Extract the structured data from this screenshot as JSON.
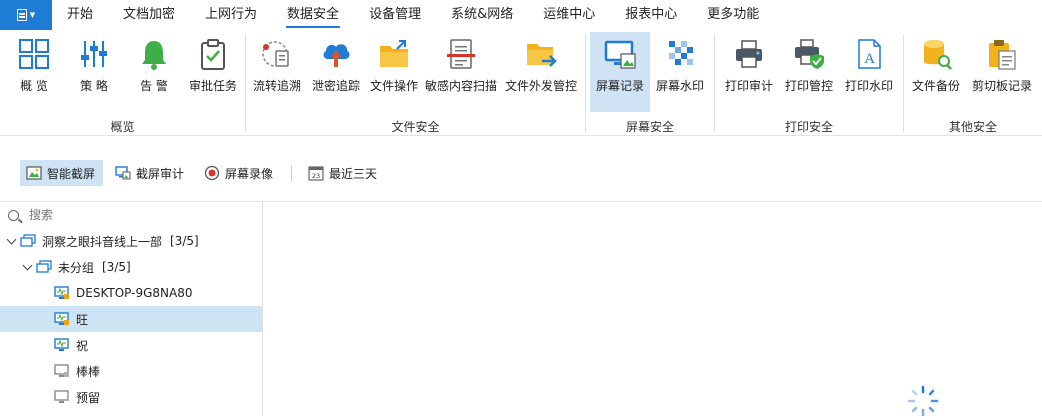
{
  "menu": {
    "items": [
      "开始",
      "文档加密",
      "上网行为",
      "数据安全",
      "设备管理",
      "系统&网络",
      "运维中心",
      "报表中心",
      "更多功能"
    ],
    "active": "数据安全"
  },
  "ribbon": {
    "buttons": {
      "overview": "概  览",
      "policy": "策  略",
      "alert": "告  警",
      "approval": "审批任务",
      "flow_trace": "流转追溯",
      "leak_trace": "泄密追踪",
      "file_ops": "文件操作",
      "sensitive_scan": "敏感内容扫描",
      "file_out": "文件外发管控",
      "screen_record": "屏幕记录",
      "screen_watermark": "屏幕水印",
      "print_audit": "打印审计",
      "print_control": "打印管控",
      "print_watermark": "打印水印",
      "file_backup": "文件备份",
      "clipboard": "剪切板记录"
    },
    "groups": {
      "overview": "概览",
      "file_security": "文件安全",
      "screen_security": "屏幕安全",
      "print_security": "打印安全",
      "other_security": "其他安全"
    }
  },
  "toolbar": {
    "smart_capture": "智能截屏",
    "capture_audit": "截屏审计",
    "screen_video": "屏幕录像",
    "recent_range": "最近三天",
    "calendar_day": "23"
  },
  "tree": {
    "search_placeholder": "搜索",
    "root": {
      "label": "洞察之眼抖音线上一部",
      "count": "[3/5]"
    },
    "group": {
      "label": "未分组",
      "count": "[3/5]"
    },
    "devices": [
      "DESKTOP-9G8NA80",
      "旺",
      "祝",
      "棒棒",
      "预留"
    ]
  },
  "colors": {
    "accent": "#1e7bd6",
    "selection": "#cde4f5",
    "online_device": "#1e7bd6",
    "offline_device": "#8a8a8a",
    "alert_badge": "#e8a317"
  }
}
